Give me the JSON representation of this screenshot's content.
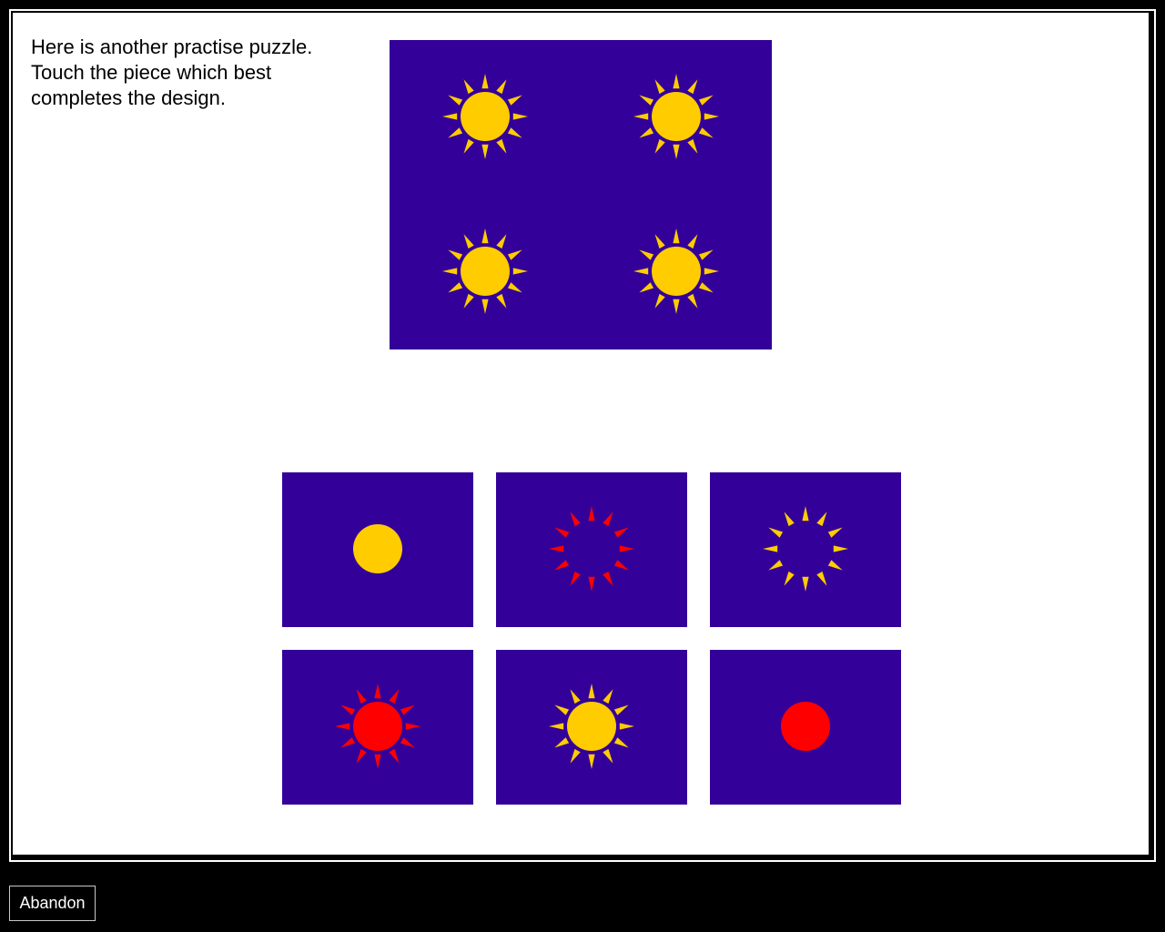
{
  "instructions": {
    "line1": "Here is another practise puzzle.",
    "line2": "Touch the piece which best",
    "line3": "completes the design."
  },
  "colors": {
    "panel_background": "#330099",
    "yellow": "#ffcc00",
    "red": "#ff0000",
    "page_background": "#000000",
    "frame": "#ffffff"
  },
  "puzzle": {
    "suns": [
      {
        "body": "yellow",
        "rays": "yellow"
      },
      {
        "body": "yellow",
        "rays": "yellow"
      },
      {
        "body": "yellow",
        "rays": "yellow"
      },
      {
        "body": "yellow",
        "rays": "yellow"
      }
    ]
  },
  "options": [
    {
      "id": "option-1",
      "body": "yellow",
      "rays": "none"
    },
    {
      "id": "option-2",
      "body": "none",
      "rays": "red"
    },
    {
      "id": "option-3",
      "body": "none",
      "rays": "yellow"
    },
    {
      "id": "option-4",
      "body": "red",
      "rays": "red"
    },
    {
      "id": "option-5",
      "body": "yellow",
      "rays": "yellow"
    },
    {
      "id": "option-6",
      "body": "red",
      "rays": "none"
    }
  ],
  "abandon_label": "Abandon"
}
